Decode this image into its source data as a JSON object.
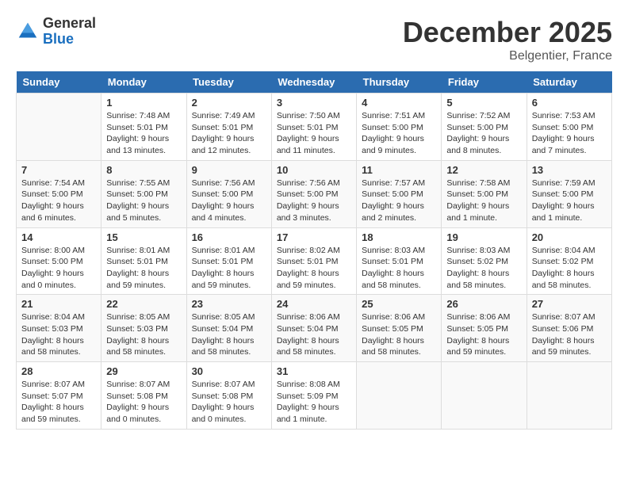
{
  "header": {
    "logo_general": "General",
    "logo_blue": "Blue",
    "month_title": "December 2025",
    "location": "Belgentier, France"
  },
  "weekdays": [
    "Sunday",
    "Monday",
    "Tuesday",
    "Wednesday",
    "Thursday",
    "Friday",
    "Saturday"
  ],
  "weeks": [
    [
      {
        "day": "",
        "sunrise": "",
        "sunset": "",
        "daylight": ""
      },
      {
        "day": "1",
        "sunrise": "Sunrise: 7:48 AM",
        "sunset": "Sunset: 5:01 PM",
        "daylight": "Daylight: 9 hours and 13 minutes."
      },
      {
        "day": "2",
        "sunrise": "Sunrise: 7:49 AM",
        "sunset": "Sunset: 5:01 PM",
        "daylight": "Daylight: 9 hours and 12 minutes."
      },
      {
        "day": "3",
        "sunrise": "Sunrise: 7:50 AM",
        "sunset": "Sunset: 5:01 PM",
        "daylight": "Daylight: 9 hours and 11 minutes."
      },
      {
        "day": "4",
        "sunrise": "Sunrise: 7:51 AM",
        "sunset": "Sunset: 5:00 PM",
        "daylight": "Daylight: 9 hours and 9 minutes."
      },
      {
        "day": "5",
        "sunrise": "Sunrise: 7:52 AM",
        "sunset": "Sunset: 5:00 PM",
        "daylight": "Daylight: 9 hours and 8 minutes."
      },
      {
        "day": "6",
        "sunrise": "Sunrise: 7:53 AM",
        "sunset": "Sunset: 5:00 PM",
        "daylight": "Daylight: 9 hours and 7 minutes."
      }
    ],
    [
      {
        "day": "7",
        "sunrise": "Sunrise: 7:54 AM",
        "sunset": "Sunset: 5:00 PM",
        "daylight": "Daylight: 9 hours and 6 minutes."
      },
      {
        "day": "8",
        "sunrise": "Sunrise: 7:55 AM",
        "sunset": "Sunset: 5:00 PM",
        "daylight": "Daylight: 9 hours and 5 minutes."
      },
      {
        "day": "9",
        "sunrise": "Sunrise: 7:56 AM",
        "sunset": "Sunset: 5:00 PM",
        "daylight": "Daylight: 9 hours and 4 minutes."
      },
      {
        "day": "10",
        "sunrise": "Sunrise: 7:56 AM",
        "sunset": "Sunset: 5:00 PM",
        "daylight": "Daylight: 9 hours and 3 minutes."
      },
      {
        "day": "11",
        "sunrise": "Sunrise: 7:57 AM",
        "sunset": "Sunset: 5:00 PM",
        "daylight": "Daylight: 9 hours and 2 minutes."
      },
      {
        "day": "12",
        "sunrise": "Sunrise: 7:58 AM",
        "sunset": "Sunset: 5:00 PM",
        "daylight": "Daylight: 9 hours and 1 minute."
      },
      {
        "day": "13",
        "sunrise": "Sunrise: 7:59 AM",
        "sunset": "Sunset: 5:00 PM",
        "daylight": "Daylight: 9 hours and 1 minute."
      }
    ],
    [
      {
        "day": "14",
        "sunrise": "Sunrise: 8:00 AM",
        "sunset": "Sunset: 5:00 PM",
        "daylight": "Daylight: 9 hours and 0 minutes."
      },
      {
        "day": "15",
        "sunrise": "Sunrise: 8:01 AM",
        "sunset": "Sunset: 5:01 PM",
        "daylight": "Daylight: 8 hours and 59 minutes."
      },
      {
        "day": "16",
        "sunrise": "Sunrise: 8:01 AM",
        "sunset": "Sunset: 5:01 PM",
        "daylight": "Daylight: 8 hours and 59 minutes."
      },
      {
        "day": "17",
        "sunrise": "Sunrise: 8:02 AM",
        "sunset": "Sunset: 5:01 PM",
        "daylight": "Daylight: 8 hours and 59 minutes."
      },
      {
        "day": "18",
        "sunrise": "Sunrise: 8:03 AM",
        "sunset": "Sunset: 5:01 PM",
        "daylight": "Daylight: 8 hours and 58 minutes."
      },
      {
        "day": "19",
        "sunrise": "Sunrise: 8:03 AM",
        "sunset": "Sunset: 5:02 PM",
        "daylight": "Daylight: 8 hours and 58 minutes."
      },
      {
        "day": "20",
        "sunrise": "Sunrise: 8:04 AM",
        "sunset": "Sunset: 5:02 PM",
        "daylight": "Daylight: 8 hours and 58 minutes."
      }
    ],
    [
      {
        "day": "21",
        "sunrise": "Sunrise: 8:04 AM",
        "sunset": "Sunset: 5:03 PM",
        "daylight": "Daylight: 8 hours and 58 minutes."
      },
      {
        "day": "22",
        "sunrise": "Sunrise: 8:05 AM",
        "sunset": "Sunset: 5:03 PM",
        "daylight": "Daylight: 8 hours and 58 minutes."
      },
      {
        "day": "23",
        "sunrise": "Sunrise: 8:05 AM",
        "sunset": "Sunset: 5:04 PM",
        "daylight": "Daylight: 8 hours and 58 minutes."
      },
      {
        "day": "24",
        "sunrise": "Sunrise: 8:06 AM",
        "sunset": "Sunset: 5:04 PM",
        "daylight": "Daylight: 8 hours and 58 minutes."
      },
      {
        "day": "25",
        "sunrise": "Sunrise: 8:06 AM",
        "sunset": "Sunset: 5:05 PM",
        "daylight": "Daylight: 8 hours and 58 minutes."
      },
      {
        "day": "26",
        "sunrise": "Sunrise: 8:06 AM",
        "sunset": "Sunset: 5:05 PM",
        "daylight": "Daylight: 8 hours and 59 minutes."
      },
      {
        "day": "27",
        "sunrise": "Sunrise: 8:07 AM",
        "sunset": "Sunset: 5:06 PM",
        "daylight": "Daylight: 8 hours and 59 minutes."
      }
    ],
    [
      {
        "day": "28",
        "sunrise": "Sunrise: 8:07 AM",
        "sunset": "Sunset: 5:07 PM",
        "daylight": "Daylight: 8 hours and 59 minutes."
      },
      {
        "day": "29",
        "sunrise": "Sunrise: 8:07 AM",
        "sunset": "Sunset: 5:08 PM",
        "daylight": "Daylight: 9 hours and 0 minutes."
      },
      {
        "day": "30",
        "sunrise": "Sunrise: 8:07 AM",
        "sunset": "Sunset: 5:08 PM",
        "daylight": "Daylight: 9 hours and 0 minutes."
      },
      {
        "day": "31",
        "sunrise": "Sunrise: 8:08 AM",
        "sunset": "Sunset: 5:09 PM",
        "daylight": "Daylight: 9 hours and 1 minute."
      },
      {
        "day": "",
        "sunrise": "",
        "sunset": "",
        "daylight": ""
      },
      {
        "day": "",
        "sunrise": "",
        "sunset": "",
        "daylight": ""
      },
      {
        "day": "",
        "sunrise": "",
        "sunset": "",
        "daylight": ""
      }
    ]
  ]
}
